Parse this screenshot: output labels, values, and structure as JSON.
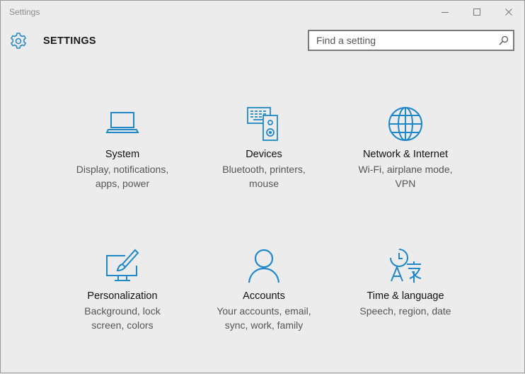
{
  "window": {
    "title": "Settings"
  },
  "header": {
    "title": "SETTINGS",
    "icon": "gear-icon"
  },
  "search": {
    "placeholder": "Find a setting",
    "icon": "search-icon"
  },
  "colors": {
    "accent": "#1e88c8",
    "background": "#ececec"
  },
  "categories": [
    {
      "title": "System",
      "desc1": "Display, notifications,",
      "desc2": "apps, power",
      "icon": "laptop-icon"
    },
    {
      "title": "Devices",
      "desc1": "Bluetooth, printers,",
      "desc2": "mouse",
      "icon": "devices-icon"
    },
    {
      "title": "Network & Internet",
      "desc1": "Wi-Fi, airplane mode,",
      "desc2": "VPN",
      "icon": "globe-icon"
    },
    {
      "title": "Personalization",
      "desc1": "Background, lock",
      "desc2": "screen, colors",
      "icon": "paintbrush-icon"
    },
    {
      "title": "Accounts",
      "desc1": "Your accounts, email,",
      "desc2": "sync, work, family",
      "icon": "person-icon"
    },
    {
      "title": "Time & language",
      "desc1": "Speech, region, date",
      "desc2": "",
      "icon": "time-language-icon"
    }
  ]
}
